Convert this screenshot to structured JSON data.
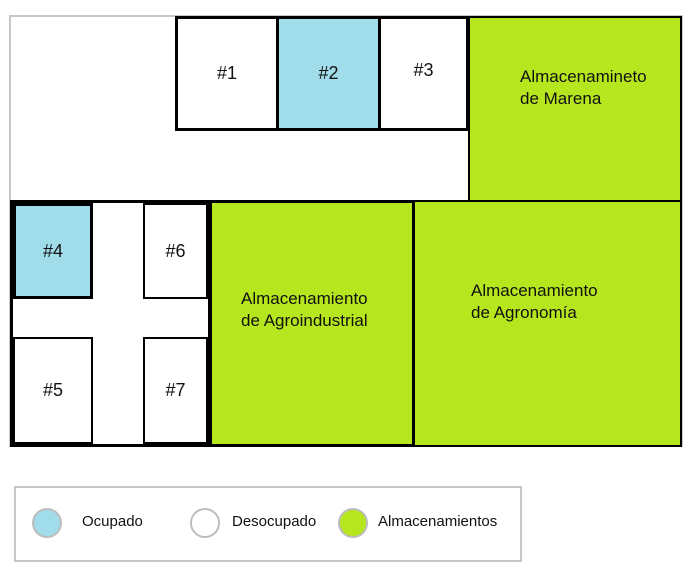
{
  "colors": {
    "occupied": "#a0dce9",
    "vacant": "#ffffff",
    "storage": "#b6e61e",
    "border": "#000000",
    "frame": "#c8c8c8"
  },
  "rooms": {
    "r1": {
      "label": "#1",
      "status": "Desocupado"
    },
    "r2": {
      "label": "#2",
      "status": "Ocupado"
    },
    "r3": {
      "label": "#3",
      "status": "Desocupado"
    },
    "r4": {
      "label": "#4",
      "status": "Ocupado"
    },
    "r5": {
      "label": "#5",
      "status": "Desocupado"
    },
    "r6": {
      "label": "#6",
      "status": "Desocupado"
    },
    "r7": {
      "label": "#7",
      "status": "Desocupado"
    }
  },
  "storage": {
    "marena": "Almacenamineto\nde Marena",
    "agroindustrial": "Almacenamiento\nde Agroindustrial",
    "agronomia": "Almacenamiento\nde Agronomía"
  },
  "legend": {
    "occupied": "Ocupado",
    "vacant": "Desocupado",
    "storage": "Almacenamientos"
  }
}
